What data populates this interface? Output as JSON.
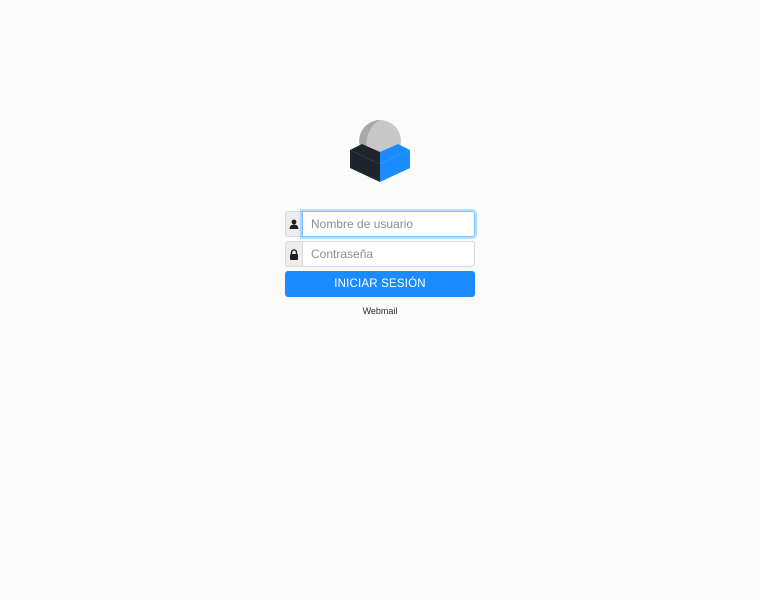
{
  "logo": {
    "icon": "roundcube-logo-icon",
    "colors": {
      "globe_light": "#c8c8c8",
      "globe_dark": "#a9a9a9",
      "box_dark": "#1e252c",
      "box_blue": "#1a8cff"
    }
  },
  "login": {
    "username": {
      "icon": "user-icon",
      "placeholder": "Nombre de usuario",
      "value": ""
    },
    "password": {
      "icon": "lock-icon",
      "placeholder": "Contraseña",
      "value": ""
    },
    "submit_label": "INICIAR SESIÓN",
    "accent_color": "#1a8cff"
  },
  "footer": {
    "link_label": "Webmail"
  }
}
